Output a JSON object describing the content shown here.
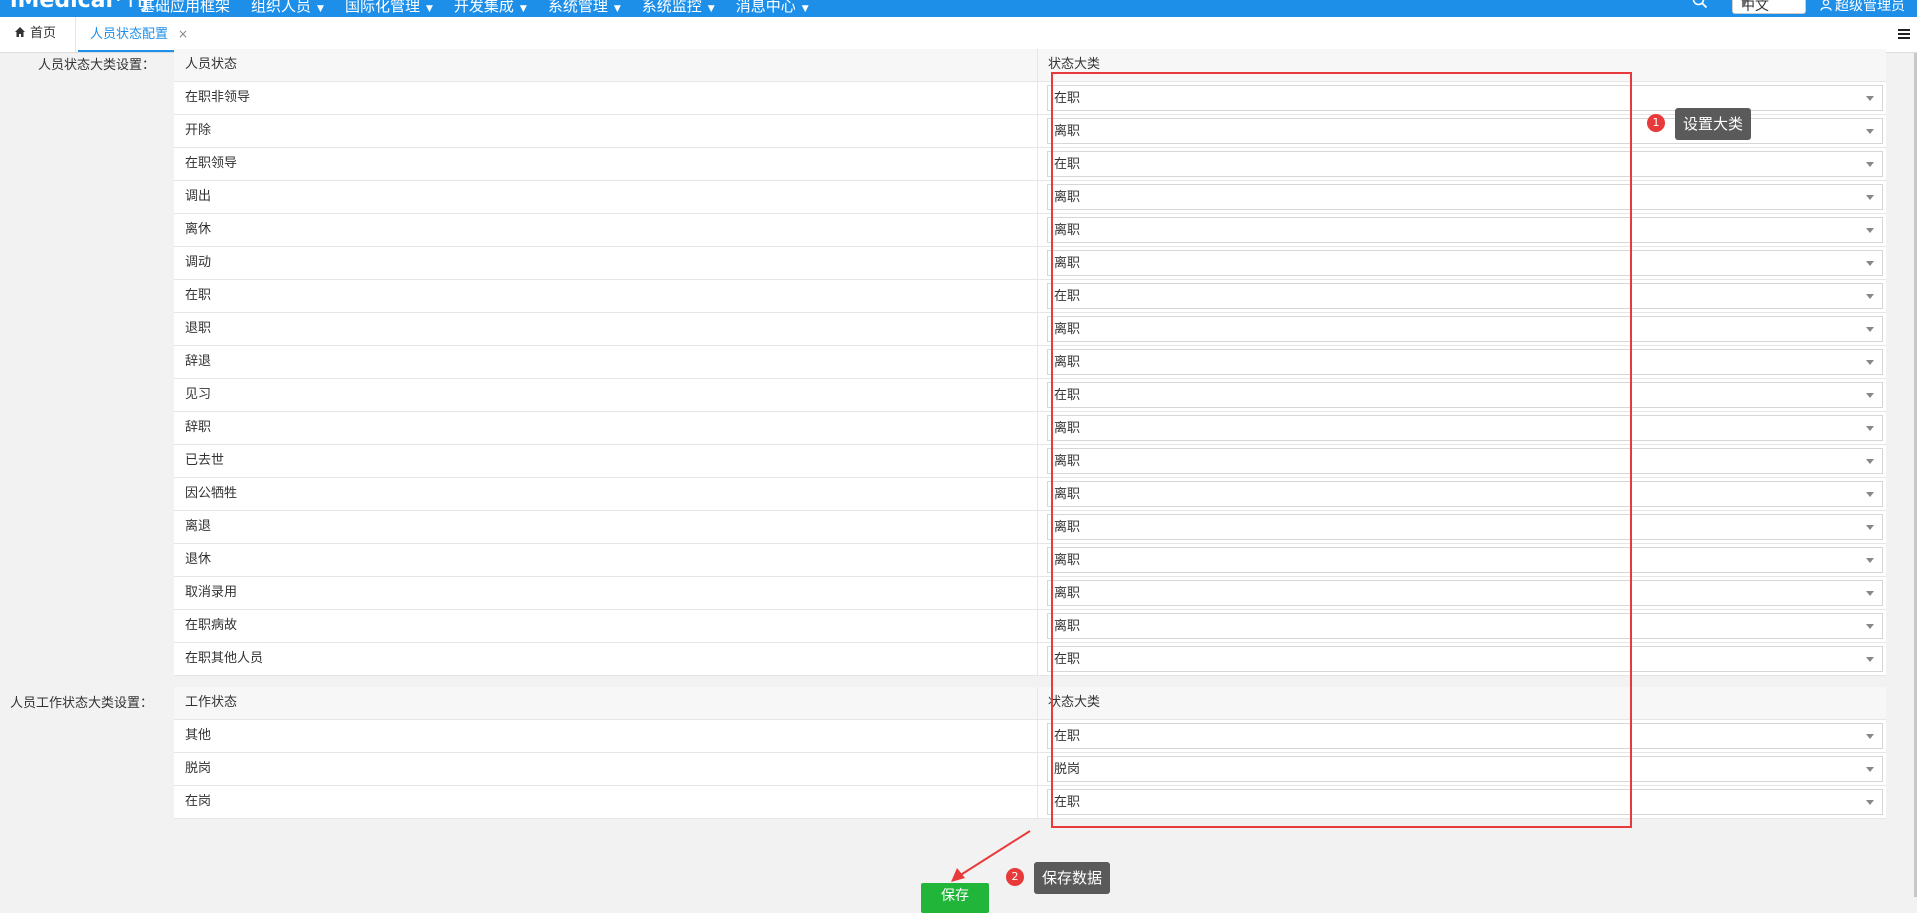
{
  "header": {
    "brand": "iMedical",
    "brand_suffix": "· HJ",
    "nav": [
      {
        "label": "基础应用框架",
        "has_caret": false
      },
      {
        "label": "组织人员",
        "has_caret": true
      },
      {
        "label": "国际化管理",
        "has_caret": true
      },
      {
        "label": "开发集成",
        "has_caret": true
      },
      {
        "label": "系统管理",
        "has_caret": true
      },
      {
        "label": "系统监控",
        "has_caret": true
      },
      {
        "label": "消息中心",
        "has_caret": true
      }
    ],
    "language": "中文",
    "user": "超级管理员",
    "icons": {
      "search": "search-icon",
      "user": "user-icon"
    }
  },
  "tabs": {
    "home_label": "首页",
    "active_label": "人员状态配置",
    "close_glyph": "×"
  },
  "staff_status": {
    "section_label": "人员状态大类设置：",
    "col_left": "人员状态",
    "col_right": "状态大类",
    "rows": [
      {
        "status": "在职非领导",
        "category": "在职"
      },
      {
        "status": "开除",
        "category": "离职"
      },
      {
        "status": "在职领导",
        "category": "在职"
      },
      {
        "status": "调出",
        "category": "离职"
      },
      {
        "status": "离休",
        "category": "离职"
      },
      {
        "status": "调动",
        "category": "离职"
      },
      {
        "status": "在职",
        "category": "在职"
      },
      {
        "status": "退职",
        "category": "离职"
      },
      {
        "status": "辞退",
        "category": "离职"
      },
      {
        "status": "见习",
        "category": "在职"
      },
      {
        "status": "辞职",
        "category": "离职"
      },
      {
        "status": "已去世",
        "category": "离职"
      },
      {
        "status": "因公牺牲",
        "category": "离职"
      },
      {
        "status": "离退",
        "category": "离职"
      },
      {
        "status": "退休",
        "category": "离职"
      },
      {
        "status": "取消录用",
        "category": "离职"
      },
      {
        "status": "在职病故",
        "category": "离职"
      },
      {
        "status": "在职其他人员",
        "category": "在职"
      }
    ]
  },
  "work_status": {
    "section_label": "人员工作状态大类设置：",
    "col_left": "工作状态",
    "col_right": "状态大类",
    "rows": [
      {
        "status": "其他",
        "category": "在职"
      },
      {
        "status": "脱岗",
        "category": "脱岗"
      },
      {
        "status": "在岗",
        "category": "在职"
      }
    ]
  },
  "annotations": {
    "tip1_num": "1",
    "tip1_text": "设置大类",
    "tip2_num": "2",
    "tip2_text": "保存数据",
    "highlight_color": "#e83a3a"
  },
  "actions": {
    "save_label": "保存"
  }
}
